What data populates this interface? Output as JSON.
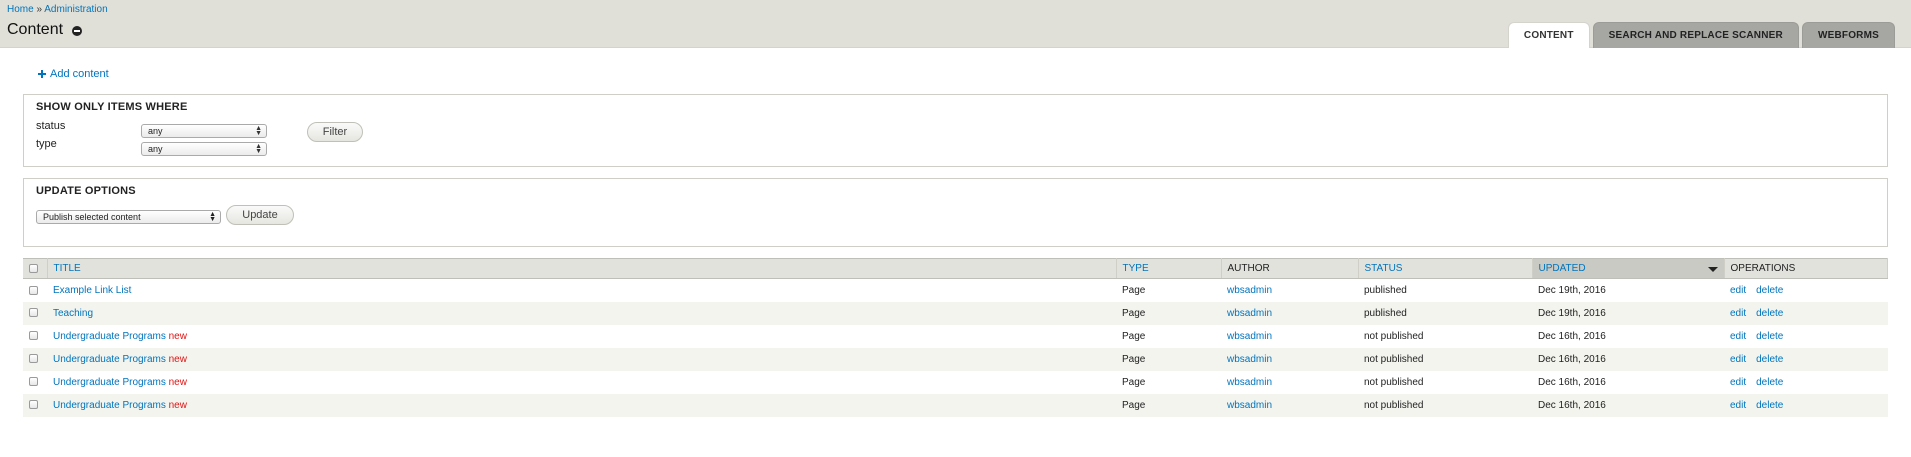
{
  "breadcrumb": {
    "home": "Home",
    "sep": "»",
    "admin": "Administration"
  },
  "page_title": "Content",
  "tabs": [
    {
      "label": "CONTENT",
      "active": true
    },
    {
      "label": "SEARCH AND REPLACE SCANNER",
      "active": false
    },
    {
      "label": "WEBFORMS",
      "active": false
    }
  ],
  "actions": {
    "add_content": "Add content"
  },
  "filter": {
    "legend": "SHOW ONLY ITEMS WHERE",
    "status_label": "status",
    "status_value": "any",
    "type_label": "type",
    "type_value": "any",
    "button": "Filter"
  },
  "update": {
    "legend": "UPDATE OPTIONS",
    "select_value": "Publish selected content",
    "button": "Update"
  },
  "table": {
    "headers": {
      "title": "TITLE",
      "type": "TYPE",
      "author": "AUTHOR",
      "status": "STATUS",
      "updated": "UPDATED",
      "operations": "OPERATIONS"
    },
    "rows": [
      {
        "title": "Example Link List",
        "new": "",
        "type": "Page",
        "author": "wbsadmin",
        "status": "published",
        "updated": "Dec 19th, 2016",
        "edit": "edit",
        "delete": "delete"
      },
      {
        "title": "Teaching",
        "new": "",
        "type": "Page",
        "author": "wbsadmin",
        "status": "published",
        "updated": "Dec 19th, 2016",
        "edit": "edit",
        "delete": "delete"
      },
      {
        "title": "Undergraduate Programs",
        "new": "new",
        "type": "Page",
        "author": "wbsadmin",
        "status": "not published",
        "updated": "Dec 16th, 2016",
        "edit": "edit",
        "delete": "delete"
      },
      {
        "title": "Undergraduate Programs",
        "new": "new",
        "type": "Page",
        "author": "wbsadmin",
        "status": "not published",
        "updated": "Dec 16th, 2016",
        "edit": "edit",
        "delete": "delete"
      },
      {
        "title": "Undergraduate Programs",
        "new": "new",
        "type": "Page",
        "author": "wbsadmin",
        "status": "not published",
        "updated": "Dec 16th, 2016",
        "edit": "edit",
        "delete": "delete"
      },
      {
        "title": "Undergraduate Programs",
        "new": "new",
        "type": "Page",
        "author": "wbsadmin",
        "status": "not published",
        "updated": "Dec 16th, 2016",
        "edit": "edit",
        "delete": "delete"
      }
    ]
  },
  "colors": {
    "link": "#0074bd",
    "new_marker": "#e21313",
    "header_bg": "#e0e0d8"
  }
}
